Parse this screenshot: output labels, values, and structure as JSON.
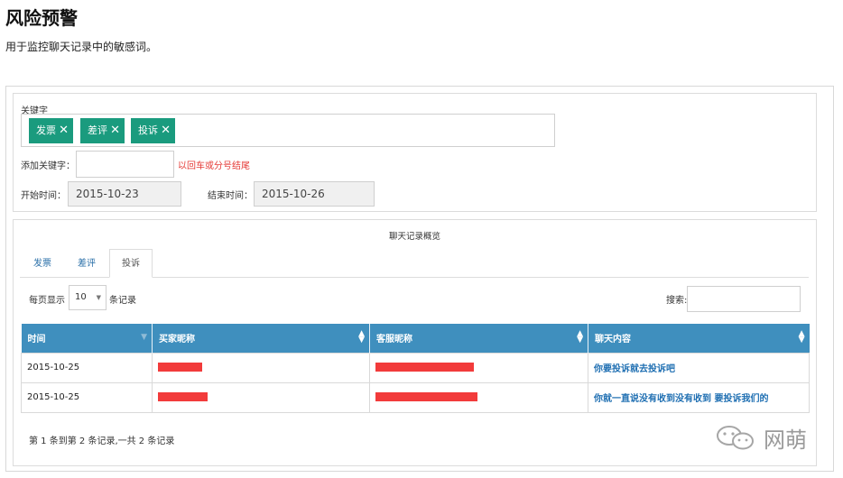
{
  "page": {
    "title": "风险预警",
    "subtitle": "用于监控聊天记录中的敏感词。"
  },
  "filter": {
    "keywords_label": "关键字",
    "tags": [
      {
        "label": "发票"
      },
      {
        "label": "差评"
      },
      {
        "label": "投诉"
      }
    ],
    "tag_close_glyph": "✕",
    "add_keyword_label": "添加关键字：",
    "add_keyword_value": "",
    "add_keyword_hint": "以回车或分号结尾",
    "start_label": "开始时间：",
    "start_value": "2015-10-23",
    "end_label": "结束时间：",
    "end_value": "2015-10-26"
  },
  "records": {
    "title": "聊天记录概览",
    "tabs": [
      {
        "label": "发票",
        "active": false
      },
      {
        "label": "差评",
        "active": false
      },
      {
        "label": "投诉",
        "active": true
      }
    ],
    "length_prefix": "每页显示",
    "length_value": "10",
    "length_suffix": "条记录",
    "search_label": "搜索:",
    "search_value": "",
    "columns": [
      "时间",
      "买家昵称",
      "客服昵称",
      "聊天内容"
    ],
    "rows": [
      {
        "time": "2015-10-25",
        "buyer": "[redacted]",
        "agent": "[redacted]",
        "content": "你要投诉就去投诉吧"
      },
      {
        "time": "2015-10-25",
        "buyer": "[redacted]",
        "agent": "[redacted]",
        "content": "你就一直说没有收到没有收到 要投诉我们的"
      }
    ],
    "info": "第 1 条到第 2 条记录,一共 2 条记录"
  },
  "watermark": {
    "text": "网萌",
    "icon": "wechat-icon"
  },
  "colors": {
    "tag": "#1a9b7e",
    "table_header": "#3f8fbe",
    "hint": "#e53935",
    "link": "#1f6fb2",
    "redaction": "#f23b3b"
  }
}
